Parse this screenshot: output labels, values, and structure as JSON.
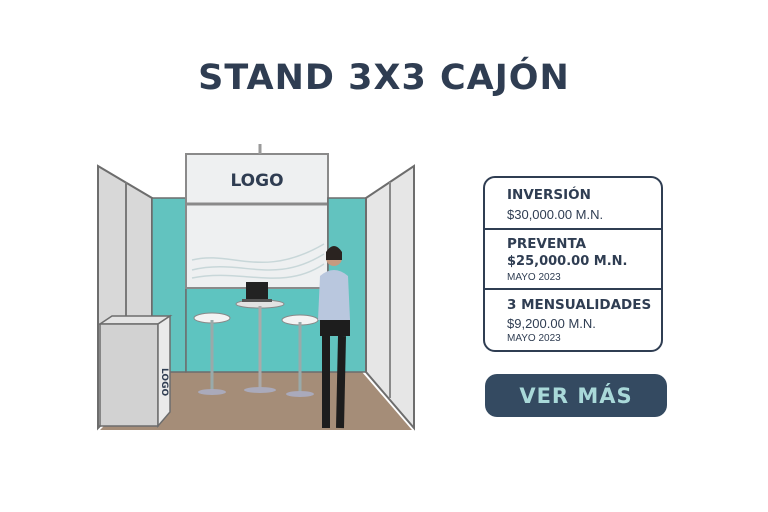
{
  "title": "STAND 3X3 CAJÓN",
  "booth": {
    "logo_text": "LOGO",
    "counter_logo_text": "LOGO"
  },
  "pricing": [
    {
      "label": "INVERSIÓN",
      "amount": "$30,000.00 M.N.",
      "note": ""
    },
    {
      "label": "PREVENTA",
      "amount": "$25,000.00 M.N.",
      "note": "MAYO 2023"
    },
    {
      "label": "3 MENSUALIDADES",
      "amount": "$9,200.00 M.N.",
      "note": "MAYO 2023"
    }
  ],
  "cta": {
    "label": "VER MÁS"
  },
  "colors": {
    "navy": "#2f3d52",
    "teal": "#5ec4c0",
    "cta_bg": "#344a61",
    "cta_text": "#a9d9d9"
  }
}
